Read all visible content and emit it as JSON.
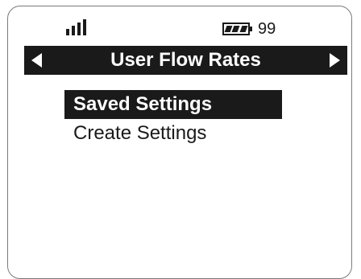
{
  "status_bar": {
    "signal_icon": "signal-bars-icon",
    "battery_icon": "battery-icon",
    "battery_value": "99"
  },
  "header": {
    "title": "User Flow Rates",
    "prev_icon": "arrow-left-icon",
    "next_icon": "arrow-right-icon"
  },
  "menu": {
    "items": [
      {
        "label": "Saved Settings",
        "selected": true
      },
      {
        "label": "Create Settings",
        "selected": false
      }
    ]
  },
  "colors": {
    "foreground": "#1a1a1a",
    "background": "#ffffff",
    "border": "#7a7a7a"
  }
}
